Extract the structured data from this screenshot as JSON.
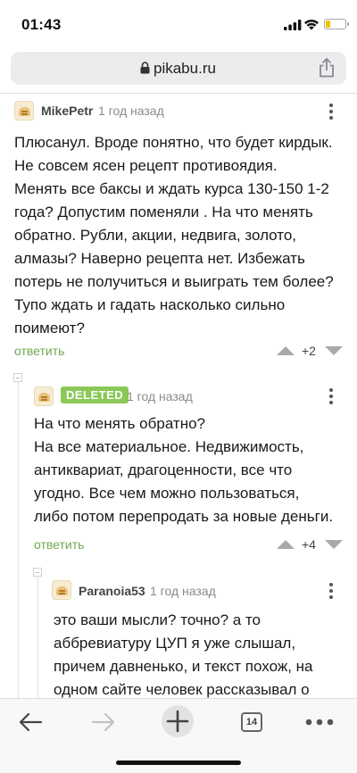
{
  "status_bar": {
    "time": "01:43"
  },
  "browser": {
    "url": "pikabu.ru",
    "tab_count": "14"
  },
  "comments": [
    {
      "author": "MikePetr",
      "time_ago": "1 год назад",
      "text_lines": [
        "Плюсанул. Вроде понятно, что будет кирдык.",
        "Не совсем ясен рецепт противоядия.",
        "Менять все баксы и ждать курса 130-150 1-2",
        "года?  Допустим поменяли . На что менять",
        "обратно. Рубли, акции, недвига, золото,",
        "алмазы? Наверно рецепта нет.  Избежать",
        "потерь не получиться и выиграть тем более?",
        "Тупо ждать и гадать насколько сильно",
        "поимеют?"
      ],
      "reply_label": "ответить",
      "rating": "+2"
    },
    {
      "author_badge": "DELETED",
      "time_ago": "1 год назад",
      "text_lines": [
        "На что менять обратно?",
        "На все материальное. Недвижимость,",
        "антиквариат, драгоценности, все что",
        "угодно. Все чем можно пользоваться,",
        "либо потом перепродать за новые деньги."
      ],
      "reply_label": "ответить",
      "rating": "+4"
    },
    {
      "author": "Paranoia53",
      "time_ago": "1 год назад",
      "text_lines": [
        "это ваши мысли? точно? а то",
        "аббревиатуру ЦУП я уже слышал,",
        "причем давненько, и текст похож, на",
        "одном сайте человек рассказывал о"
      ]
    }
  ],
  "icons": {
    "signal": "cellular-signal-icon",
    "wifi": "wifi-icon",
    "battery": "battery-icon",
    "lock": "lock-icon",
    "share": "share-icon",
    "back": "back-arrow-icon",
    "forward": "forward-arrow-icon",
    "new_tab": "plus-icon",
    "tabs": "tabs-icon",
    "more": "more-horizontal-icon"
  },
  "colors": {
    "accent_green": "#6fa84e",
    "badge_green": "#8ac858",
    "vote_gray": "#a9a9a9",
    "battery_yellow": "#f2c200"
  }
}
